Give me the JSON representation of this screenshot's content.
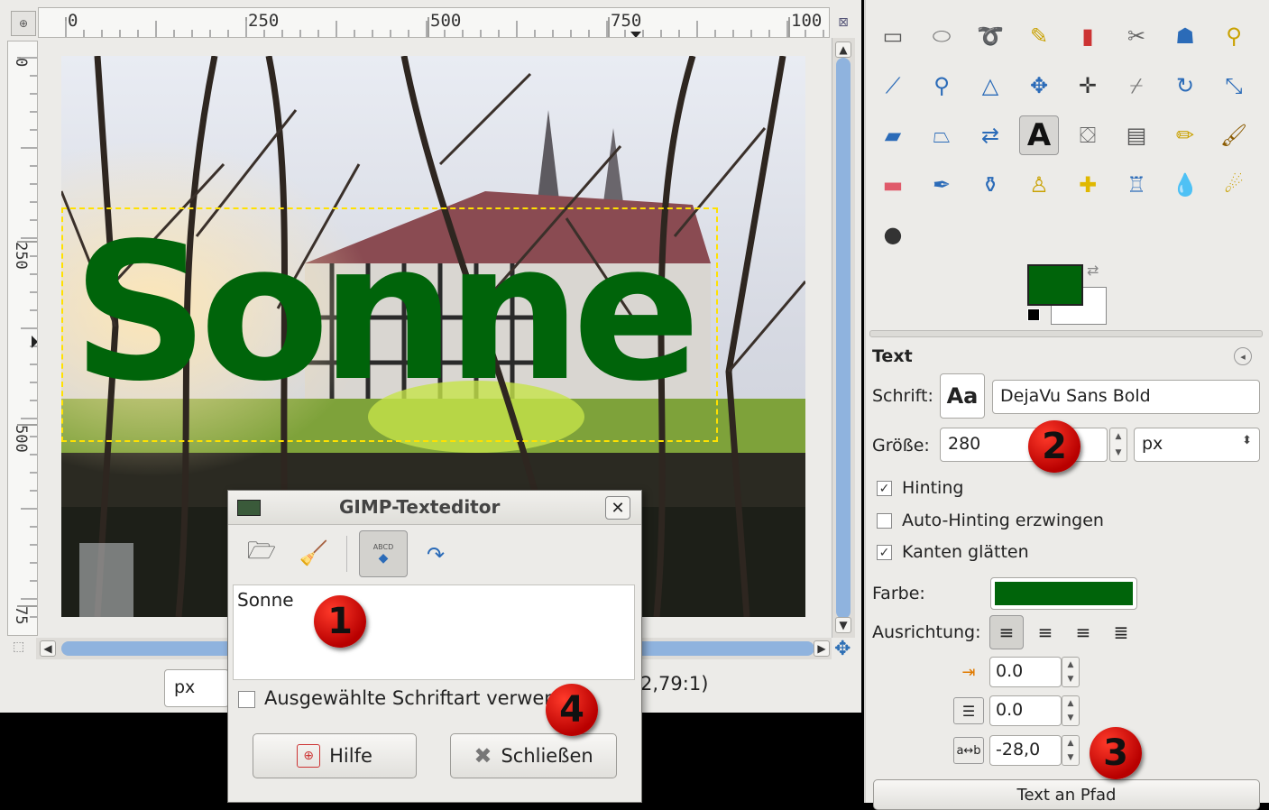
{
  "canvas": {
    "ruler_h_labels": [
      "0",
      "250",
      "500",
      "750",
      "100"
    ],
    "ruler_v_labels": [
      "0",
      "250",
      "500",
      "75"
    ],
    "text_layer": "Sonne",
    "text_color": "#00640a",
    "unit": "px",
    "zoom_partial": "2,79:1)"
  },
  "toolbox": {
    "tools": [
      "rect-select-icon",
      "ellipse-select-icon",
      "lasso-icon",
      "fuzzy-select-icon",
      "color-select-icon",
      "scissors-icon",
      "foreground-select-icon",
      "paths-icon",
      "color-picker-icon",
      "zoom-icon",
      "measure-icon",
      "move-icon",
      "align-icon",
      "crop-icon",
      "rotate-icon",
      "scale-icon",
      "shear-icon",
      "perspective-icon",
      "flip-icon",
      "text-icon",
      "bucket-fill-icon",
      "blend-icon",
      "pencil-icon",
      "paintbrush-icon",
      "eraser-icon",
      "airbrush-icon",
      "ink-icon",
      "clone-icon",
      "heal-icon",
      "perspective-clone-icon",
      "blur-icon",
      "smudge-icon",
      "dodge-burn-icon"
    ],
    "active_tool": "text-icon",
    "fg_color": "#00640a",
    "bg_color": "#ffffff"
  },
  "text_options": {
    "title": "Text",
    "font_label": "Schrift:",
    "font_button": "Aa",
    "font_value": "DejaVu Sans Bold",
    "size_label": "Größe:",
    "size_value": "280",
    "size_unit": "px",
    "hinting_label": "Hinting",
    "hinting_checked": true,
    "autohint_label": "Auto-Hinting erzwingen",
    "autohint_checked": false,
    "antialias_label": "Kanten glätten",
    "antialias_checked": true,
    "color_label": "Farbe:",
    "color_value": "#00640a",
    "justify_label": "Ausrichtung:",
    "indent_value": "0.0",
    "line_spacing_value": "0.0",
    "letter_spacing_value": "-28,0",
    "path_button": "Text an Pfad"
  },
  "dialog": {
    "title": "GIMP-Texteditor",
    "text": "Sonne",
    "use_font_label": "Ausgewählte Schriftart verwenden",
    "help_button": "Hilfe",
    "close_button": "Schließen"
  },
  "markers": [
    "1",
    "2",
    "3",
    "4"
  ]
}
